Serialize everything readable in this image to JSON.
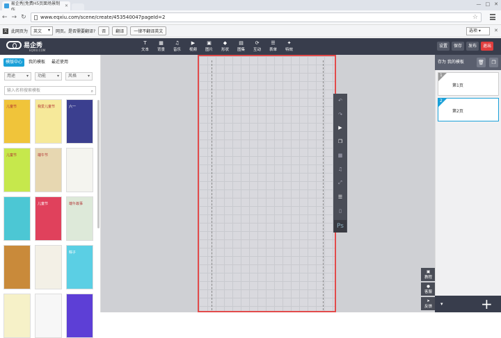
{
  "browser": {
    "tab_title": "易企秀|免费H5页面场景制作",
    "url": "www.eqxiu.com/scene/create/453540047pageId=2"
  },
  "translate_bar": {
    "label": "此网页为",
    "language": "英文",
    "question": "网页。是否需要翻译?",
    "no": "否",
    "translate": "翻译",
    "never": "一律不翻译英文",
    "options": "选项"
  },
  "app": {
    "logo_text": "易企秀",
    "logo_sub": "EQXIU.COM",
    "tools": [
      {
        "label": "文本",
        "icon": "text-icon"
      },
      {
        "label": "背景",
        "icon": "background-icon"
      },
      {
        "label": "音乐",
        "icon": "music-icon"
      },
      {
        "label": "视频",
        "icon": "video-icon"
      },
      {
        "label": "图片",
        "icon": "image-icon"
      },
      {
        "label": "形状",
        "icon": "shape-icon"
      },
      {
        "label": "图集",
        "icon": "gallery-icon"
      },
      {
        "label": "互动",
        "icon": "interact-icon"
      },
      {
        "label": "表单",
        "icon": "form-icon"
      },
      {
        "label": "特效",
        "icon": "effect-icon"
      }
    ],
    "actions": {
      "settings": "设置",
      "save": "保存",
      "publish": "发布",
      "exit": "退出"
    }
  },
  "left_panel": {
    "tabs": [
      "模版中心",
      "我的模板",
      "最近使用"
    ],
    "filters": [
      "用途",
      "功能",
      "风格"
    ],
    "search_placeholder": "输入名称搜索模板",
    "templates": [
      {
        "label": "儿童节",
        "color": "#f0c43a"
      },
      {
        "label": "我爱儿童节",
        "color": "#f6e99a"
      },
      {
        "label": "六一",
        "color": "#3b3f8f"
      },
      {
        "label": "儿童节",
        "color": "#c6e84c"
      },
      {
        "label": "端午节",
        "color": "#e7d7b1"
      },
      {
        "label": "",
        "color": "#f4f4ef"
      },
      {
        "label": "",
        "color": "#4cc7d4"
      },
      {
        "label": "儿童节",
        "color": "#e0415c"
      },
      {
        "label": "端午故事",
        "color": "#dde9d9"
      },
      {
        "label": "",
        "color": "#c98a3a"
      },
      {
        "label": "",
        "color": "#f3f0e6"
      },
      {
        "label": "粽子",
        "color": "#5bcfe4"
      },
      {
        "label": "",
        "color": "#f6f1c8"
      },
      {
        "label": "",
        "color": "#f7f7f7"
      },
      {
        "label": "",
        "color": "#5d3fd6"
      }
    ]
  },
  "right_panel": {
    "header": "存为 我的模板",
    "pages": [
      {
        "num": "1",
        "title": "第1页",
        "color": "#999"
      },
      {
        "num": "2",
        "title": "第2页",
        "color": "#1aa0d8"
      }
    ]
  },
  "helpers": [
    "教程",
    "客服",
    "反馈"
  ]
}
